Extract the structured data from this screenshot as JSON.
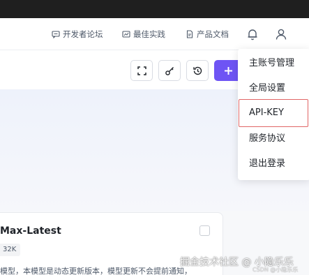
{
  "header": {
    "links": [
      {
        "label": "开发者论坛",
        "icon": "forum-icon"
      },
      {
        "label": "最佳实践",
        "icon": "practice-icon"
      },
      {
        "label": "产品文档",
        "icon": "document-icon"
      }
    ],
    "icons": [
      "bell-icon",
      "user-icon"
    ]
  },
  "toolbar": {
    "buttons": [
      "fullscreen-icon",
      "key-icon",
      "history-icon",
      "plus-icon"
    ],
    "accent_color": "#6e54f4"
  },
  "card": {
    "title": "Max-Latest",
    "badge": "32K",
    "description": "模型，本模型是动态更新版本，模型更新不会提前通知，"
  },
  "dropdown": {
    "items": [
      "主账号管理",
      "全局设置",
      "API-KEY",
      "服务协议",
      "退出登录"
    ],
    "highlighted_item": "API-KEY",
    "highlight_color": "#e06666"
  },
  "watermark": {
    "main": "掘金技术社区 @ 小隐乐乐",
    "sub": "CSDN @小隐乐乐"
  }
}
